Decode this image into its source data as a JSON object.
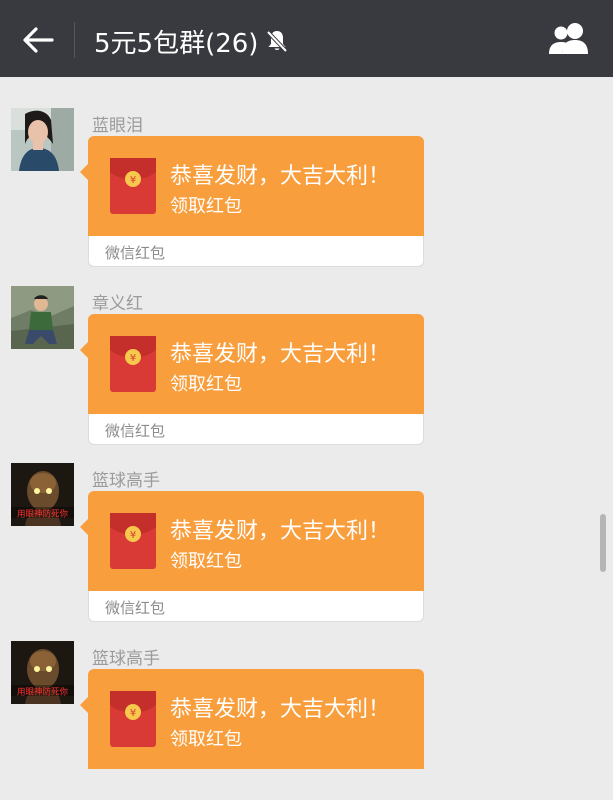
{
  "header": {
    "title": "5元5包群(26)",
    "icons": {
      "back": "arrow-left-icon",
      "mute": "bell-off-icon",
      "members": "group-members-icon"
    }
  },
  "messages": [
    {
      "sender": "蓝眼泪",
      "greeting": "恭喜发财，大吉大利！",
      "action": "领取红包",
      "brand": "微信红包",
      "avatar_caption": ""
    },
    {
      "sender": "章义红",
      "greeting": "恭喜发财，大吉大利！",
      "action": "领取红包",
      "brand": "微信红包",
      "avatar_caption": ""
    },
    {
      "sender": "篮球高手",
      "greeting": "恭喜发财，大吉大利！",
      "action": "领取红包",
      "brand": "微信红包",
      "avatar_caption": "用眼神防死你"
    },
    {
      "sender": "篮球高手",
      "greeting": "恭喜发财，大吉大利！",
      "action": "领取红包",
      "brand": "微信红包",
      "avatar_caption": "用眼神防死你"
    }
  ],
  "colors": {
    "header_bg": "#393a3f",
    "page_bg": "#ebebeb",
    "packet_orange": "#f89e3d",
    "envelope_red": "#d93a36",
    "coin_gold": "#f6c84c"
  },
  "currency_symbol": "¥"
}
